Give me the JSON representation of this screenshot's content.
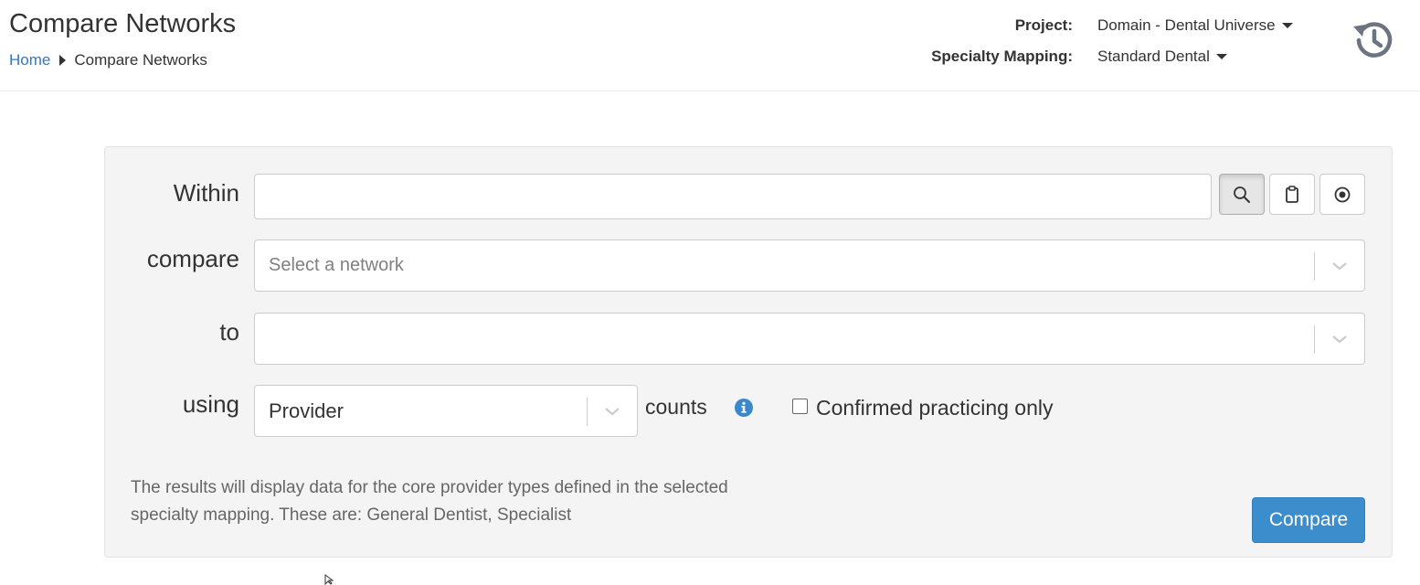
{
  "header": {
    "title": "Compare Networks",
    "breadcrumb": {
      "home": "Home",
      "current": "Compare Networks"
    },
    "project": {
      "label": "Project:",
      "value": "Domain - Dental Universe"
    },
    "specialty_mapping": {
      "label": "Specialty Mapping:",
      "value": "Standard Dental"
    },
    "history_icon": "history-icon"
  },
  "form": {
    "within": {
      "label": "Within",
      "value": "",
      "buttons": [
        "search-icon",
        "clipboard-icon",
        "target-icon"
      ]
    },
    "compare": {
      "label": "compare",
      "placeholder": "Select a network"
    },
    "to": {
      "label": "to",
      "value": ""
    },
    "using": {
      "label": "using",
      "value": "Provider",
      "suffix": "counts"
    },
    "confirmed_practicing": {
      "label": "Confirmed practicing only",
      "checked": false
    },
    "help_text": "The results will display data for the core provider types defined in the selected specialty mapping. These are: General Dentist, Specialist",
    "compare_button": "Compare"
  },
  "colors": {
    "link": "#337ab7",
    "primary_button": "#3c8dcc",
    "panel_background": "#f4f4f4",
    "info_icon": "#3a87cb"
  }
}
